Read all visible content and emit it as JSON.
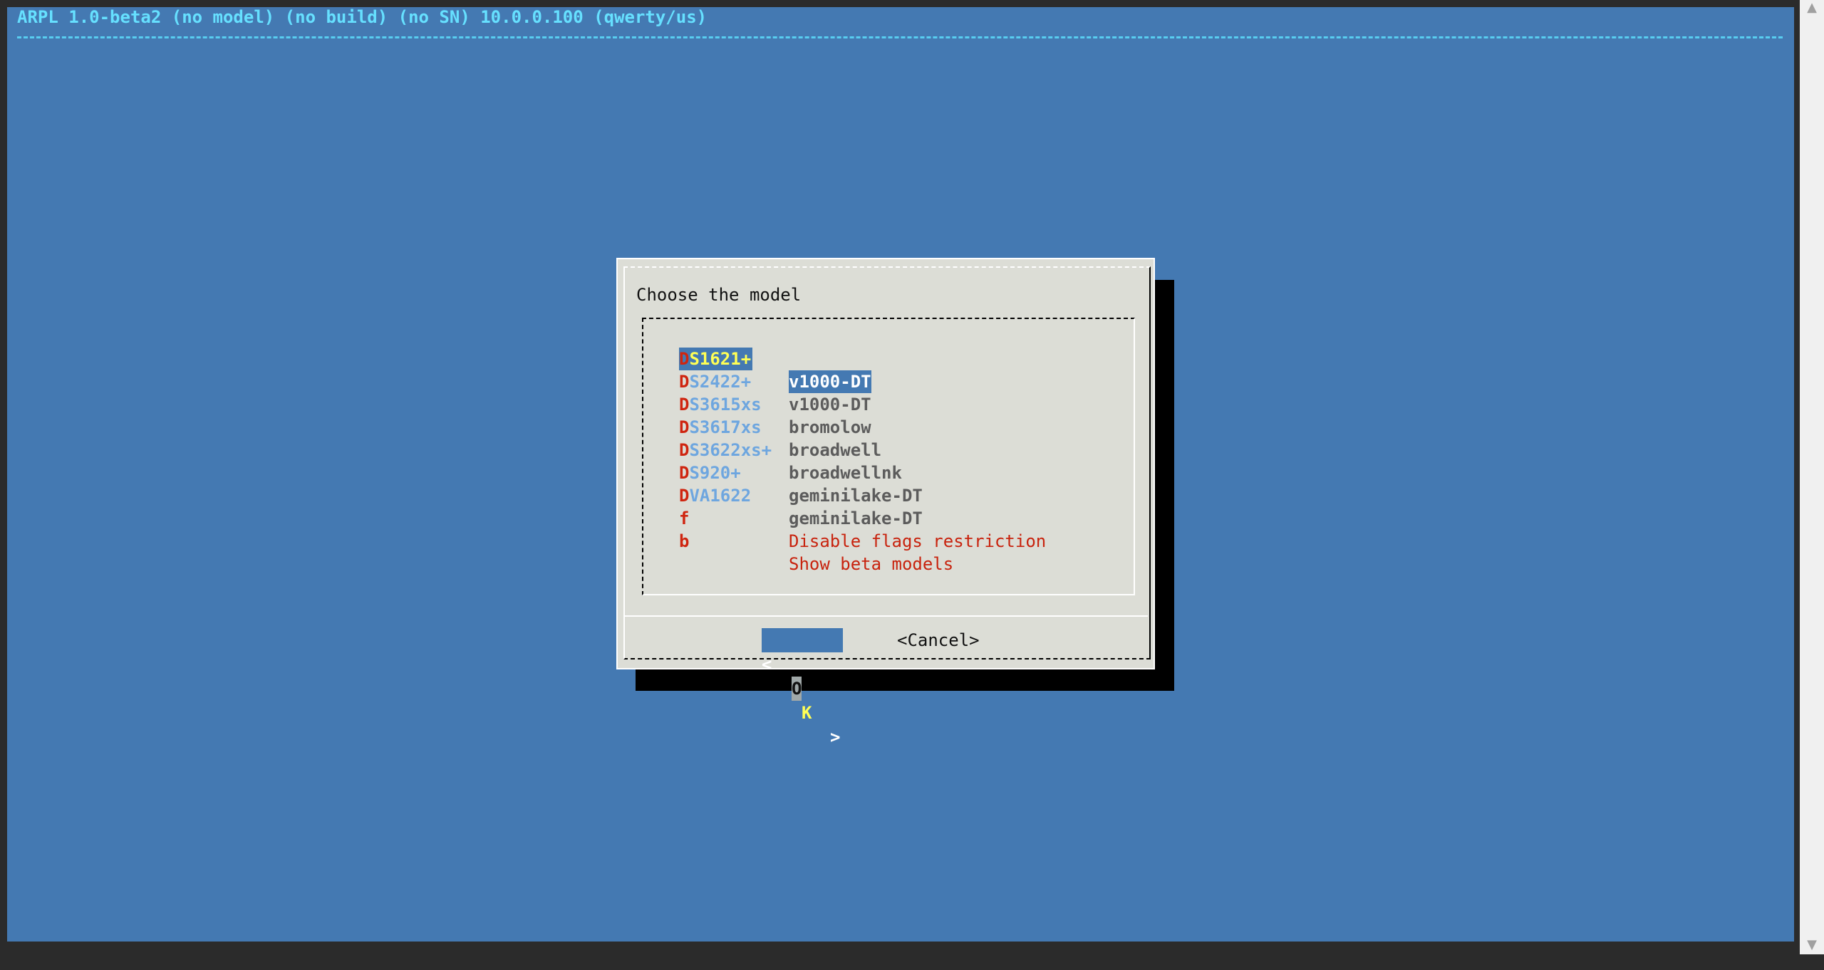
{
  "backtitle": "ARPL 1.0-beta2 (no model) (no build) (no SN) 10.0.0.100 (qwerty/us)",
  "dialog": {
    "title": "Choose the model",
    "items": [
      {
        "hot": "D",
        "rest": "S1621+",
        "desc": "v1000-DT",
        "selected": true
      },
      {
        "hot": "D",
        "rest": "S2422+",
        "desc": "v1000-DT"
      },
      {
        "hot": "D",
        "rest": "S3615xs",
        "desc": "bromolow"
      },
      {
        "hot": "D",
        "rest": "S3617xs",
        "desc": "broadwell"
      },
      {
        "hot": "D",
        "rest": "S3622xs+",
        "desc": "broadwellnk"
      },
      {
        "hot": "D",
        "rest": "S920+",
        "desc": "geminilake-DT"
      },
      {
        "hot": "D",
        "rest": "VA1622",
        "desc": "geminilake-DT"
      },
      {
        "hot": "f",
        "rest": "",
        "desc": "Disable flags restriction"
      },
      {
        "hot": "b",
        "rest": "",
        "desc": "Show beta models"
      }
    ],
    "ok": {
      "left": "<",
      "o": "O",
      "k": "K",
      "right": ">"
    },
    "cancel": "<Cancel>"
  },
  "scrollbar": {
    "up_icon": "▲",
    "down_icon": "▼"
  }
}
